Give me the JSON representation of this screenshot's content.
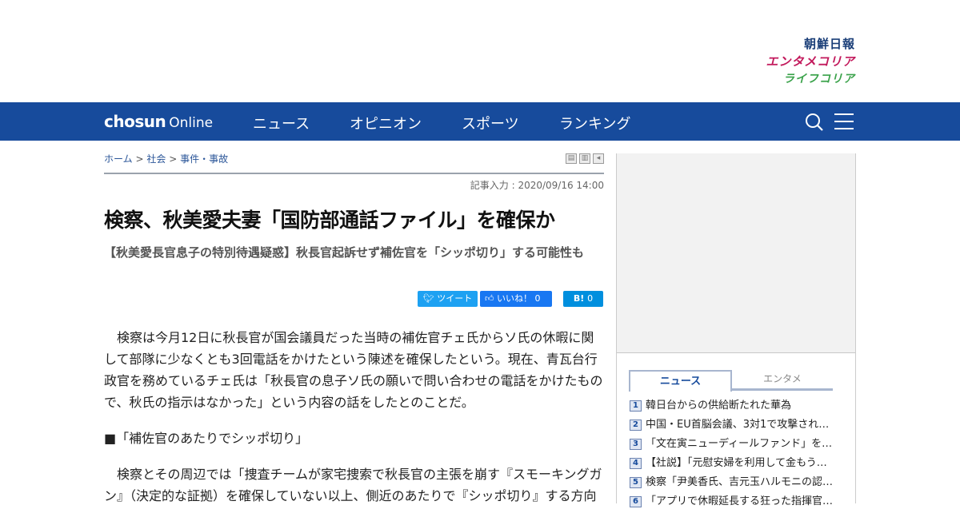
{
  "brands": {
    "chosun_ilbo": "朝鮮日報",
    "entame_korea": "エンタメコリア",
    "life_korea": "ライフコリア"
  },
  "nav": {
    "logo_main": "chosun",
    "logo_sub": "Online",
    "items": [
      "ニュース",
      "オピニオン",
      "スポーツ",
      "ランキング"
    ]
  },
  "breadcrumb": {
    "home": "ホーム",
    "sep": ">",
    "section": "社会",
    "category": "事件・事故"
  },
  "article": {
    "date": "記事入力 : 2020/09/16 14:00",
    "headline": "検察、秋美愛夫妻「国防部通話ファイル」を確保か",
    "subhead": "【秋美愛長官息子の特別待遇疑惑】秋長官起訴せず補佐官を「シッポ切り」する可能性も",
    "paragraphs": [
      "検察は今月12日に秋長官が国会議員だった当時の補佐官チェ氏からソ氏の休暇に関して部隊に少なくとも3回電話をかけたという陳述を確保したという。現在、青瓦台行政官を務めているチェ氏は「秋長官の息子ソ氏の願いで問い合わせの電話をかけたもので、秋氏の指示はなかった」という内容の話をしたとのことだ。",
      "■「補佐官のあたりでシッポ切り」",
      "検察とその周辺では「捜査チームが家宅捜索で秋長官の主張を崩す『スモーキングガン』（決定的な証拠）を確保していない以上、側近のあたりで『シッポ切り』する方向"
    ]
  },
  "share": {
    "tweet": "ツイート",
    "like": "いいね！",
    "like_count": "0",
    "hatena": "B!",
    "hatena_count": "0"
  },
  "sidebar": {
    "tabs": [
      "ニュース",
      "エンタメ"
    ],
    "ranking": [
      {
        "num": "1",
        "title": "韓日台からの供給断たれた華為"
      },
      {
        "num": "2",
        "title": "中国・EU首脳会議、3対1で攻撃され…"
      },
      {
        "num": "3",
        "title": "「文在寅ニューディールファンド」を…"
      },
      {
        "num": "4",
        "title": "【社説】「元慰安婦を利用して金もう…"
      },
      {
        "num": "5",
        "title": "検察「尹美香氏、吉元玉ハルモニの認…"
      },
      {
        "num": "6",
        "title": "「アプリで休暇延長する狂った指揮官…"
      }
    ]
  },
  "colors": {
    "nav_bg": "#174b9c",
    "link": "#2a5598",
    "brand_entame": "#c2185b",
    "brand_life": "#3aa24a"
  }
}
